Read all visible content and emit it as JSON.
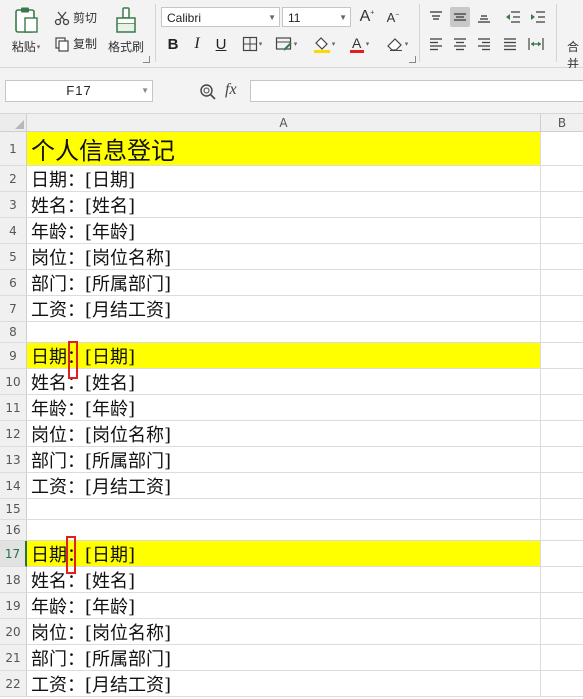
{
  "ribbon": {
    "clipboard": {
      "paste_label": "粘贴",
      "cut_label": "剪切",
      "copy_label": "复制",
      "format_painter_label": "格式刷"
    },
    "font": {
      "name": "Calibri",
      "size": "11"
    },
    "merge_label_partial": "合并"
  },
  "formula_bar": {
    "cell_ref": "F17",
    "fx_label": "fx",
    "formula_value": ""
  },
  "sheet": {
    "columns": [
      "A",
      "B"
    ],
    "selected_row": "17",
    "rows": [
      {
        "n": "1",
        "a": "个人信息登记",
        "hl": true,
        "title": true
      },
      {
        "n": "2",
        "a": "日期：[日期]"
      },
      {
        "n": "3",
        "a": "姓名：[姓名]"
      },
      {
        "n": "4",
        "a": "年龄：[年龄]"
      },
      {
        "n": "5",
        "a": "岗位：[岗位名称]"
      },
      {
        "n": "6",
        "a": "部门：[所属部门]"
      },
      {
        "n": "7",
        "a": "工资：[月结工资]"
      },
      {
        "n": "8",
        "a": ""
      },
      {
        "n": "9",
        "a": "日期：[日期]",
        "hl": true
      },
      {
        "n": "10",
        "a": "姓名：[姓名]"
      },
      {
        "n": "11",
        "a": "年龄：[年龄]"
      },
      {
        "n": "12",
        "a": "岗位：[岗位名称]"
      },
      {
        "n": "13",
        "a": "部门：[所属部门]"
      },
      {
        "n": "14",
        "a": "工资：[月结工资]"
      },
      {
        "n": "15",
        "a": ""
      },
      {
        "n": "16",
        "a": ""
      },
      {
        "n": "17",
        "a": "日期：[日期]",
        "hl": true
      },
      {
        "n": "18",
        "a": "姓名：[姓名]"
      },
      {
        "n": "19",
        "a": "年龄：[年龄]"
      },
      {
        "n": "20",
        "a": "岗位：[岗位名称]"
      },
      {
        "n": "21",
        "a": "部门：[所属部门]"
      },
      {
        "n": "22",
        "a": "工资：[月结工资]"
      }
    ]
  },
  "colors": {
    "highlight": "#ffff00",
    "annotation": "#e02020",
    "accent": "#217346"
  }
}
